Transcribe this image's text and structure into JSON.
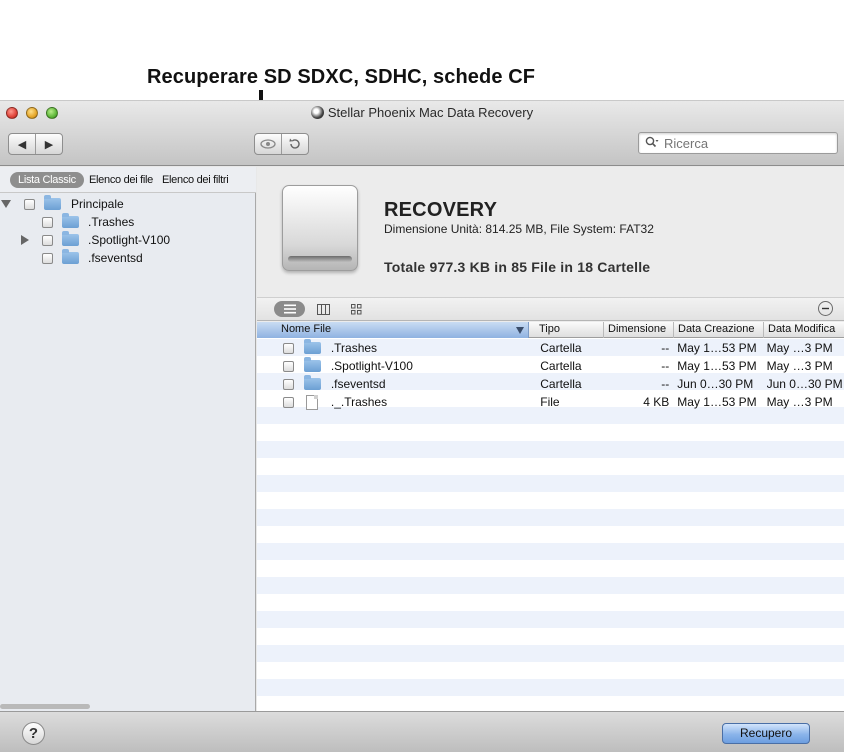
{
  "caption": "Recuperare SD SDXC, SDHC, schede CF",
  "window": {
    "title": "Stellar Phoenix Mac Data Recovery"
  },
  "toolbar": {
    "back_icon": "◀",
    "forward_icon": "▶",
    "preview_icon": "eye-icon",
    "refresh_icon": "refresh-icon",
    "search_placeholder": "Ricerca"
  },
  "sidebar": {
    "tabs": [
      {
        "label": "Lista Classic",
        "active": true
      },
      {
        "label": "Elenco dei file",
        "active": false
      },
      {
        "label": "Elenco dei filtri",
        "active": false
      }
    ],
    "tree": [
      {
        "label": "Principale",
        "expanded": true
      },
      {
        "label": ".Trashes"
      },
      {
        "label": ".Spotlight-V100",
        "collapsed": true
      },
      {
        "label": ".fseventsd"
      }
    ]
  },
  "volume": {
    "name": "RECOVERY",
    "info": "Dimensione Unità: 814.25 MB, File System:  FAT32",
    "total": "Totale 977.3 KB in 85 File in 18 Cartelle"
  },
  "table": {
    "columns": [
      "Nome File",
      "Tipo",
      "Dimensione",
      "Data Creazione",
      "Data Modifica"
    ],
    "rows": [
      {
        "name": ".Trashes",
        "type": "Cartella",
        "size": "--",
        "created": "May 1…53 PM",
        "modified": "May …3 PM",
        "icon": "folder-icon"
      },
      {
        "name": ".Spotlight-V100",
        "type": "Cartella",
        "size": "--",
        "created": "May 1…53 PM",
        "modified": "May …3 PM",
        "icon": "folder-icon"
      },
      {
        "name": ".fseventsd",
        "type": "Cartella",
        "size": "--",
        "created": "Jun 0…30 PM",
        "modified": "Jun 0…30 PM",
        "icon": "folder-icon"
      },
      {
        "name": "._.Trashes",
        "type": "File",
        "size": "4 KB",
        "created": "May 1…53 PM",
        "modified": "May …3 PM",
        "icon": "file-icon"
      }
    ]
  },
  "footer": {
    "help_label": "?",
    "recover_label": "Recupero"
  },
  "colors": {
    "accent": "#8ab4ea",
    "row_alt": "#edf2fb",
    "sidebar_bg": "#e8ebf0"
  }
}
